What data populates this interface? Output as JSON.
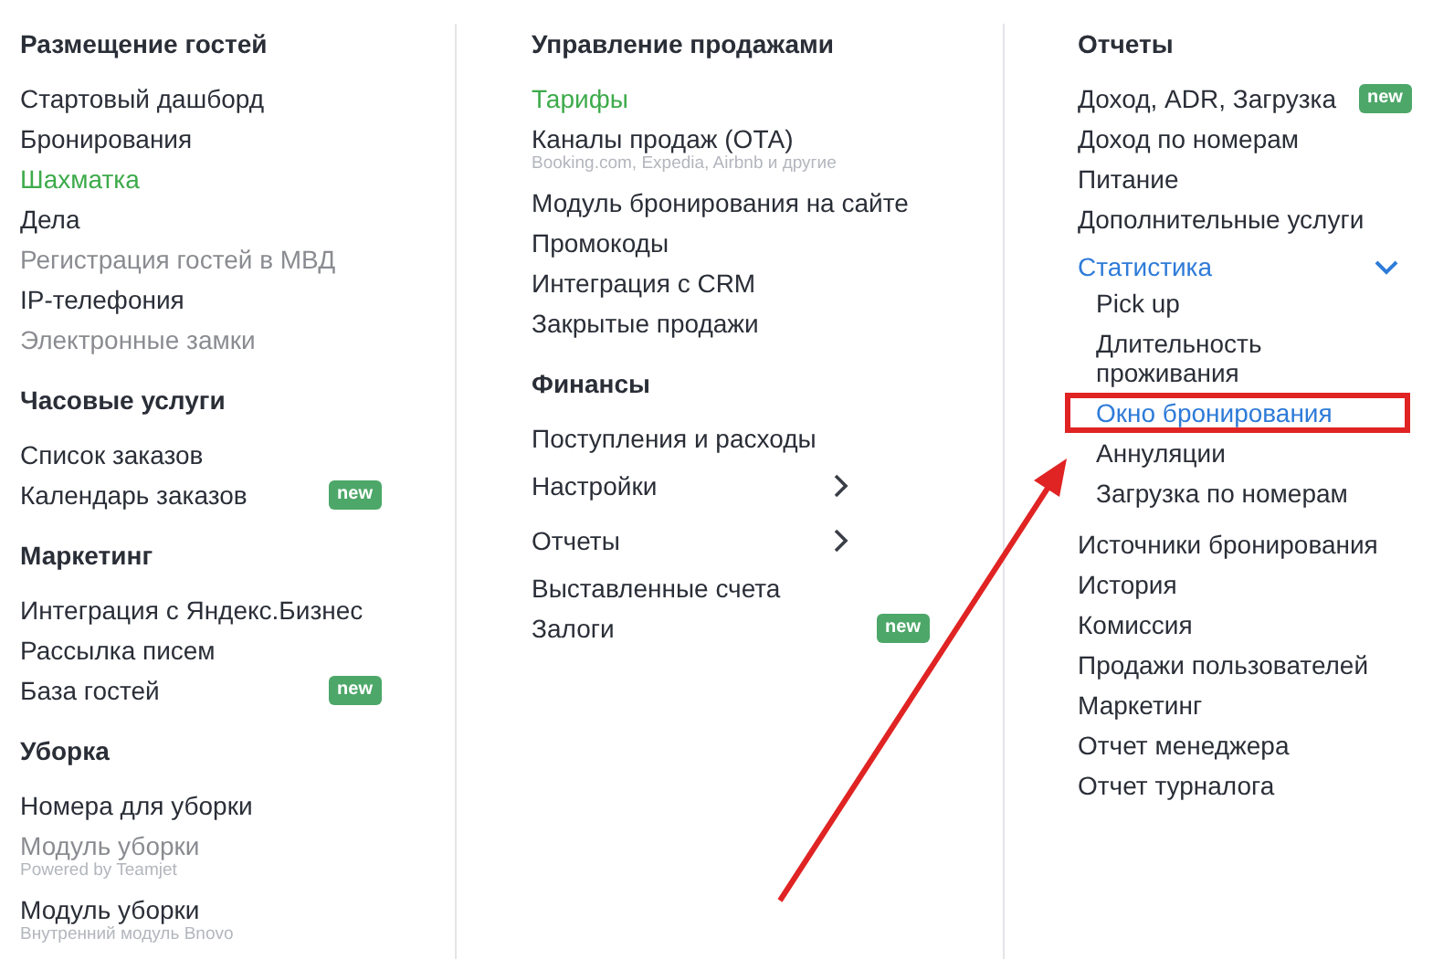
{
  "columns": [
    {
      "sections": [
        {
          "title": "Размещение гостей",
          "items": [
            {
              "label": "Стартовый дашборд",
              "kind": "link",
              "selected": false,
              "disabled": false
            },
            {
              "label": "Бронирования",
              "kind": "link",
              "selected": false,
              "disabled": false
            },
            {
              "label": "Шахматка",
              "kind": "link",
              "selected": true,
              "disabled": false
            },
            {
              "label": "Дела",
              "kind": "link",
              "selected": false,
              "disabled": false
            },
            {
              "label": "Регистрация гостей в МВД",
              "kind": "link",
              "selected": false,
              "disabled": true
            },
            {
              "label": "IP-телефония",
              "kind": "link",
              "selected": false,
              "disabled": false
            },
            {
              "label": "Электронные замки",
              "kind": "link",
              "selected": false,
              "disabled": true
            }
          ]
        },
        {
          "title": "Часовые услуги",
          "items": [
            {
              "label": "Список заказов",
              "kind": "link",
              "selected": false,
              "disabled": false
            },
            {
              "label": "Календарь заказов",
              "kind": "link",
              "selected": false,
              "disabled": false,
              "badge": "new"
            }
          ]
        },
        {
          "title": "Маркетинг",
          "items": [
            {
              "label": "Интеграция с Яндекс.Бизнес",
              "kind": "link",
              "selected": false,
              "disabled": false
            },
            {
              "label": "Рассылка писем",
              "kind": "link",
              "selected": false,
              "disabled": false
            },
            {
              "label": "База гостей",
              "kind": "link",
              "selected": false,
              "disabled": false,
              "badge": "new"
            }
          ]
        },
        {
          "title": "Уборка",
          "items": [
            {
              "label": "Номера для уборки",
              "kind": "link",
              "selected": false,
              "disabled": false
            },
            {
              "label": "Модуль уборки",
              "kind": "link",
              "selected": false,
              "disabled": true,
              "subtitle": "Powered by Teamjet"
            },
            {
              "label": "Модуль уборки",
              "kind": "link",
              "selected": false,
              "disabled": false,
              "subtitle": "Внутренний модуль Bnovo"
            }
          ]
        }
      ]
    },
    {
      "sections": [
        {
          "title": "Управление продажами",
          "items": [
            {
              "label": "Тарифы",
              "kind": "link",
              "selected": true,
              "disabled": false
            },
            {
              "label": "Каналы продаж (ОТА)",
              "kind": "link",
              "selected": false,
              "disabled": false,
              "subtitle": "Booking.com, Expedia, Airbnb и другие"
            },
            {
              "label": "Модуль бронирования на сайте",
              "kind": "link",
              "selected": false,
              "disabled": false
            },
            {
              "label": "Промокоды",
              "kind": "link",
              "selected": false,
              "disabled": false
            },
            {
              "label": "Интеграция с CRM",
              "kind": "link",
              "selected": false,
              "disabled": false
            },
            {
              "label": "Закрытые продажи",
              "kind": "link",
              "selected": false,
              "disabled": false
            }
          ]
        },
        {
          "title": "Финансы",
          "items": [
            {
              "label": "Поступления и расходы",
              "kind": "link",
              "selected": false,
              "disabled": false
            },
            {
              "label": "Настройки",
              "kind": "submenu",
              "selected": false,
              "disabled": false,
              "expanded": false
            },
            {
              "label": "Отчеты",
              "kind": "submenu",
              "selected": false,
              "disabled": false,
              "expanded": false
            },
            {
              "label": "Выставленные счета",
              "kind": "link",
              "selected": false,
              "disabled": false
            },
            {
              "label": "Залоги",
              "kind": "link",
              "selected": false,
              "disabled": false,
              "badge": "new"
            }
          ]
        }
      ]
    },
    {
      "sections": [
        {
          "title": "Отчеты",
          "items": [
            {
              "label": "Доход, ADR, Загрузка",
              "kind": "link",
              "selected": false,
              "disabled": false,
              "badge": "new"
            },
            {
              "label": "Доход по номерам",
              "kind": "link",
              "selected": false,
              "disabled": false
            },
            {
              "label": "Питание",
              "kind": "link",
              "selected": false,
              "disabled": false
            },
            {
              "label": "Дополнительные услуги",
              "kind": "link",
              "selected": false,
              "disabled": false
            },
            {
              "label": "Статистика",
              "kind": "submenu",
              "selected": false,
              "disabled": false,
              "expanded": true,
              "children": [
                {
                  "label": "Pick up",
                  "selected": false,
                  "highlighted": false
                },
                {
                  "label": "Длительность проживания",
                  "selected": false,
                  "highlighted": false
                },
                {
                  "label": "Окно бронирования",
                  "selected": true,
                  "highlighted": true
                },
                {
                  "label": "Аннуляции",
                  "selected": false,
                  "highlighted": false
                },
                {
                  "label": "Загрузка по номерам",
                  "selected": false,
                  "highlighted": false
                }
              ]
            },
            {
              "label": "Источники бронирования",
              "kind": "link",
              "selected": false,
              "disabled": false
            },
            {
              "label": "История",
              "kind": "link",
              "selected": false,
              "disabled": false
            },
            {
              "label": "Комиссия",
              "kind": "link",
              "selected": false,
              "disabled": false
            },
            {
              "label": "Продажи пользователей",
              "kind": "link",
              "selected": false,
              "disabled": false
            },
            {
              "label": "Маркетинг",
              "kind": "link",
              "selected": false,
              "disabled": false
            },
            {
              "label": "Отчет менеджера",
              "kind": "link",
              "selected": false,
              "disabled": false
            },
            {
              "label": "Отчет турналога",
              "kind": "link",
              "selected": false,
              "disabled": false
            }
          ]
        }
      ]
    }
  ],
  "annotations": [
    {
      "kind": "arrow"
    }
  ]
}
